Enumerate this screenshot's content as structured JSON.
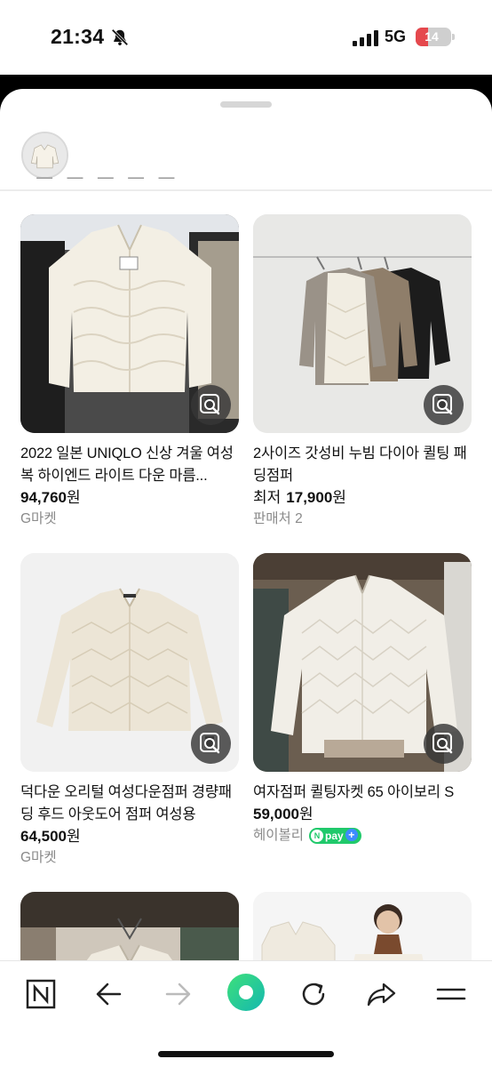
{
  "status_bar": {
    "time": "21:34",
    "network": "5G",
    "battery": "14",
    "battery_level": 0.14,
    "icons": [
      "bell-slash-icon",
      "signal-bars-icon",
      "battery-icon"
    ]
  },
  "header": {
    "thumbnail": "search-image-thumbnail"
  },
  "products": [
    {
      "title": "2022 일본 UNIQLO 신상 겨울 여성복 하이엔드 라이트 다운 마름...",
      "lowest_prefix": "",
      "price": "94,760",
      "unit": "원",
      "seller": "G마켓",
      "npay": false
    },
    {
      "title": "2사이즈 갓성비 누빔 다이아 퀼팅 패딩점퍼",
      "lowest_prefix": "최저",
      "price": "17,900",
      "unit": "원",
      "seller": "판매처 2",
      "npay": false
    },
    {
      "title": "덕다운 오리털 여성다운점퍼 경량패딩 후드 아웃도어 점퍼 여성용",
      "lowest_prefix": "",
      "price": "64,500",
      "unit": "원",
      "seller": "G마켓",
      "npay": false
    },
    {
      "title": "여자점퍼 퀼팅자켓 65 아이보리 S",
      "lowest_prefix": "",
      "price": "59,000",
      "unit": "원",
      "seller": "헤이볼리",
      "npay": true,
      "npay_label": "pay"
    }
  ],
  "bottom_nav": {
    "items": [
      "naver-n-icon",
      "back-arrow-icon",
      "forward-arrow-icon",
      "green-dot-icon",
      "reload-icon",
      "share-icon",
      "menu-icon"
    ]
  },
  "colors": {
    "accent_green": "#20c96b",
    "battery_red": "#e5484d",
    "muted_text": "#8a8a8a"
  }
}
